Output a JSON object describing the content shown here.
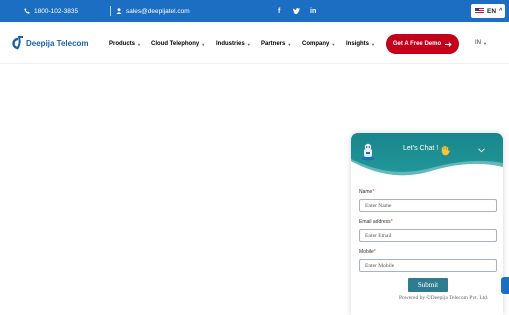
{
  "topbar": {
    "phone": "1800-102-3835",
    "email": "sales@deepijatel.com",
    "social": [
      "f",
      "t",
      "in"
    ],
    "language": "EN"
  },
  "header": {
    "logo_text": "Deepija Telecom",
    "nav": [
      "Products",
      "Cloud Telephony",
      "Industries",
      "Partners",
      "Company",
      "Insights"
    ],
    "cta_label": "Get A Free Demo",
    "region": "IN"
  },
  "chat": {
    "title": "Let's Chat !",
    "fields": [
      {
        "label": "Name",
        "placeholder": "Enter Name"
      },
      {
        "label": "Email address",
        "placeholder": "Enter Email"
      },
      {
        "label": "Mobile",
        "placeholder": "Enter Mobile"
      }
    ],
    "submit_label": "Submit",
    "powered_by": "Powered by ©Deepija Telecom Pvt. Ltd."
  },
  "colors": {
    "topbar": "#1b6ec2",
    "cta": "#c4001a",
    "chat_header": "#19868c",
    "submit": "#2d7c90"
  }
}
